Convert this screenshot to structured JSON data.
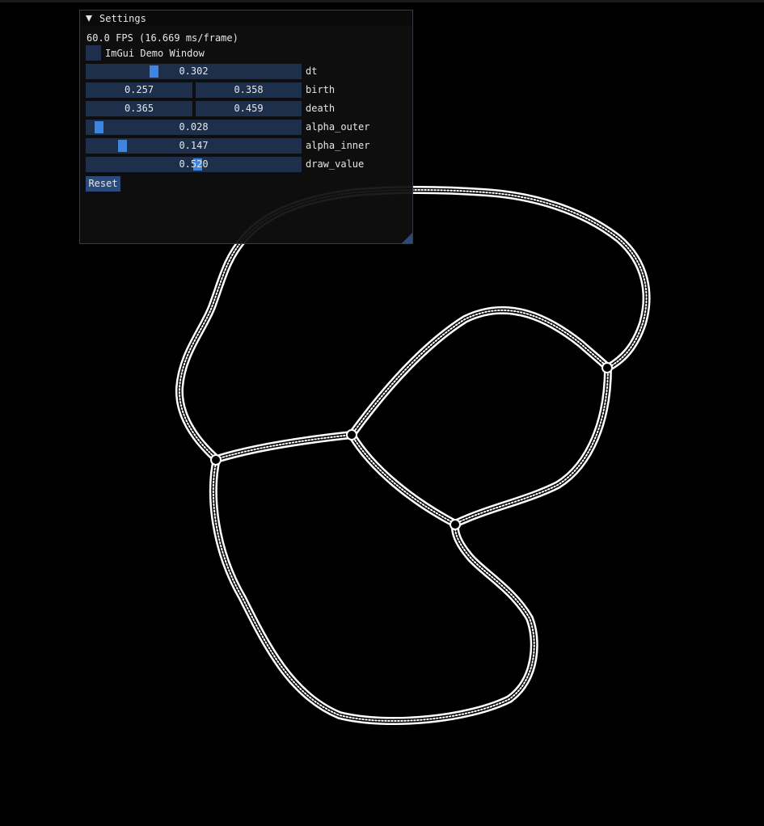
{
  "window": {
    "title": "Settings",
    "fps_text": "60.0 FPS (16.669 ms/frame)",
    "demo_checkbox_label": "ImGui Demo Window",
    "demo_checkbox_checked": false,
    "reset_label": "Reset"
  },
  "params": {
    "dt": {
      "label": "dt",
      "value": "0.302",
      "fraction": 0.302
    },
    "birth": {
      "label": "birth",
      "min": "0.257",
      "max": "0.358"
    },
    "death": {
      "label": "death",
      "min": "0.365",
      "max": "0.459"
    },
    "alpha_outer": {
      "label": "alpha_outer",
      "value": "0.028",
      "fraction": 0.028
    },
    "alpha_inner": {
      "label": "alpha_inner",
      "value": "0.147",
      "fraction": 0.147
    },
    "draw_value": {
      "label": "draw_value",
      "value": "0.520",
      "fraction": 0.52
    }
  },
  "colors": {
    "background": "#000000",
    "window_bg": "#0f0f0f",
    "frame_bg": "#1d2f4b",
    "slider_grab": "#3d85e0",
    "button": "#294a7a",
    "text": "#e6e6e6",
    "pattern": "#ffffff"
  }
}
